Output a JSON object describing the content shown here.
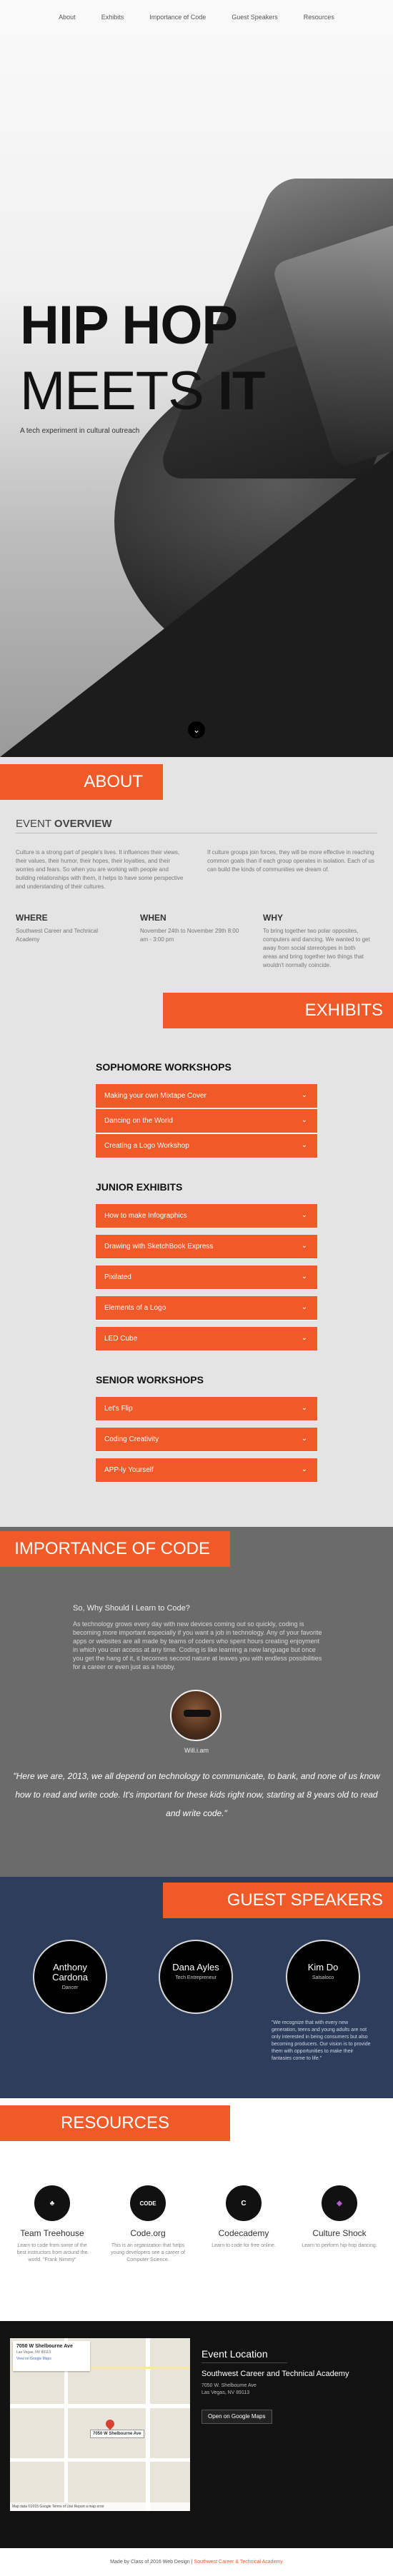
{
  "nav": {
    "items": [
      "About",
      "Exhibits",
      "Importance of Code",
      "Guest Speakers",
      "Resources"
    ]
  },
  "hero": {
    "title_line1": "HIP HOP",
    "title_line2_light": "MEETS ",
    "title_line2_bold": "IT",
    "subtitle": "A tech experiment in cultural outreach",
    "scroll_icon": "chevron-down-icon"
  },
  "about": {
    "heading": "ABOUT",
    "event_light": "EVENT ",
    "event_bold": "OVERVIEW",
    "paragraph_left": "Culture is a strong part of people's lives. It influences their views, their values, their humor, their hopes, their loyalties, and their worries and fears. So when you are working with people and building relationships with them, it helps to have some perspective and understanding of their cultures.",
    "paragraph_right": "If culture groups join forces, they will be more effective in reaching common goals than if each group operates in isolation. Each of us can build the kinds of communities we dream of.",
    "where": {
      "label": "WHERE",
      "text": "Southwest Career and Technical Academy"
    },
    "when": {
      "label": "WHEN",
      "text": "November 24th to November 29th 8:00 am - 3:00 pm"
    },
    "why": {
      "label": "WHY",
      "text": "To bring together two polar opposites, computers and dancing. We wanted to get away from social stereotypes in both areas and bring together two things that wouldn't normally coincide."
    }
  },
  "exhibits": {
    "heading": "EXHIBITS",
    "groups": [
      {
        "title": "SOPHOMORE WORKSHOPS",
        "items": [
          "Making your own Mixtape Cover",
          "Dancing on the World",
          "Creating a Logo Workshop"
        ]
      },
      {
        "title": "JUNIOR EXHIBITS",
        "items": [
          "How to make Infographics",
          "Drawing with SketchBook Express",
          "Pixilated",
          "Elements of a Logo",
          "LED Cube"
        ]
      },
      {
        "title": "SENIOR WORKSHOPS",
        "items": [
          "Let's Flip",
          "Coding Creativity",
          "APP-ly Yourself"
        ]
      }
    ]
  },
  "importance": {
    "heading": "IMPORTANCE OF CODE",
    "question": "So, Why Should I Learn to Code?",
    "paragraph": "As technology grows every day with new devices coming out so quickly, coding is becoming more important especially if you want a job in technology. Any of your favorite apps or websites are all made by teams of coders who spent hours creating enjoyment in which you can access at any time. Coding is like learning a new language but once you get the hang of it, it becomes second nature at leaves you with endless possibilities for a career or even just as a hobby.",
    "person_name": "Will.i.am",
    "quote": "\"Here we are, 2013, we all depend on technology to communicate, to bank, and none of us know how to read and write code. It's important for these kids right now, starting at 8 years old to read and write code.\""
  },
  "guests": {
    "heading": "GUEST SPEAKERS",
    "speakers": [
      {
        "name": "Anthony Cardona",
        "role": "Dancer"
      },
      {
        "name": "Dana Ayles",
        "role": "Tech Entrepreneur"
      },
      {
        "name": "Kim Do",
        "role": "Salsaloco"
      }
    ],
    "quote": "\"We recognize that with every new generation, teens and young adults are not only interested in being consumers but also becoming producers. Our vision is to provide them with opportunities to make their fantasies come to life.\""
  },
  "resources": {
    "heading": "RESOURCES",
    "items": [
      {
        "name": "Team Treehouse",
        "icon": "treehouse-icon",
        "icon_text": "♣",
        "desc": "Learn to code from some of the best instructors from around the world. \"Frank Nimmy\""
      },
      {
        "name": "Code.org",
        "icon": "code-org-icon",
        "icon_text": "CODE",
        "desc": "This is an organization that helps young developers see a career of Computer Science."
      },
      {
        "name": "Codecademy",
        "icon": "codecademy-icon",
        "icon_text": "C",
        "desc": "Learn to code for free online."
      },
      {
        "name": "Culture Shock",
        "icon": "culture-shock-icon",
        "icon_text": "◆",
        "desc": "Learn to perform hip-hop dancing."
      }
    ]
  },
  "location": {
    "map_card_title": "7050 W Shelbourne Ave",
    "map_card_address": "Las Vegas, NV 89113",
    "map_card_link": "View on Google Maps",
    "map_marker_label": "7050 W Shelbourne Ave",
    "map_footer": "Map data ©2015 Google  Terms of Use  Report a map error",
    "heading": "Event Location",
    "name": "Southwest Career and Technical Academy",
    "address_line1": "7050 W. Shelbourne Ave",
    "address_line2": "Las Vegas, NV 89113",
    "button": "Open on Google Maps"
  },
  "footer": {
    "text_prefix": "Made by Class of 2016 Web Design | ",
    "text_accent": "Southwest Career & Technical Academy"
  },
  "colors": {
    "accent": "#f05a28",
    "navy": "#2e3d5c",
    "gray_section": "#6b6b6b"
  }
}
